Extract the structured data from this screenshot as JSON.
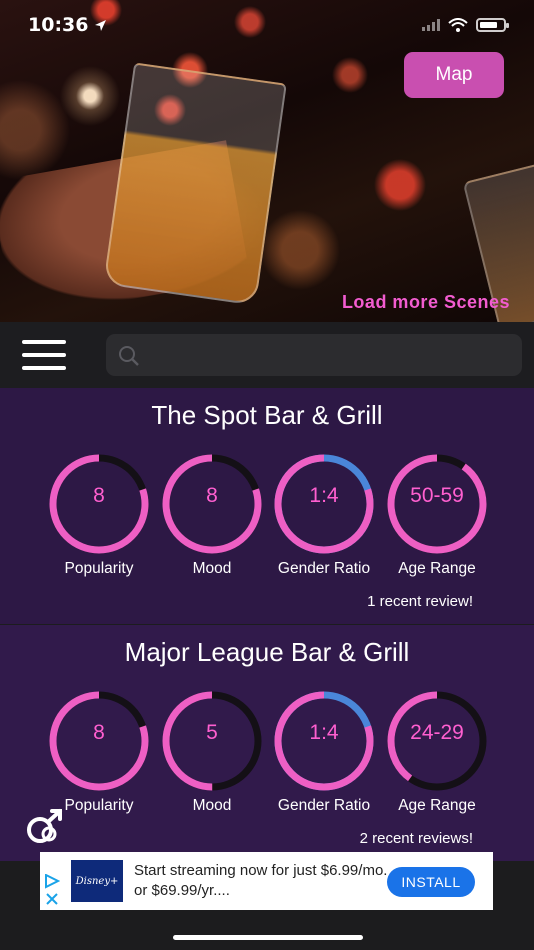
{
  "status_bar": {
    "time": "10:36",
    "battery_percent": 75
  },
  "hero": {
    "map_button": "Map",
    "load_more": "Load more Scenes"
  },
  "search": {
    "placeholder": "",
    "value": ""
  },
  "colors": {
    "accent": "#c94fb0",
    "ring_pink": "#ee5fc4",
    "ring_blue": "#4a86d9",
    "ring_track": "#141016",
    "card_bg": "#2e1845"
  },
  "venues": [
    {
      "name": "The Spot Bar & Grill",
      "stats": [
        {
          "label": "Popularity",
          "value": "8",
          "fill_fraction": 0.8
        },
        {
          "label": "Mood",
          "value": "8",
          "fill_fraction": 0.8
        },
        {
          "label": "Gender Ratio",
          "value": "1:4",
          "fill_fraction": 0.8
        },
        {
          "label": "Age Range",
          "value": "50-59",
          "fill_fraction": 0.9
        }
      ],
      "reviews": "1 recent review!"
    },
    {
      "name": "Major League Bar & Grill",
      "stats": [
        {
          "label": "Popularity",
          "value": "8",
          "fill_fraction": 0.8
        },
        {
          "label": "Mood",
          "value": "5",
          "fill_fraction": 0.5
        },
        {
          "label": "Gender Ratio",
          "value": "1:4",
          "fill_fraction": 0.8
        },
        {
          "label": "Age Range",
          "value": "24-29",
          "fill_fraction": 0.4
        }
      ],
      "reviews": "2 recent reviews!"
    }
  ],
  "ad": {
    "brand": "Disney+",
    "text": "Start streaming now for just $6.99/mo. or $69.99/yr....",
    "install_label": "INSTALL"
  }
}
